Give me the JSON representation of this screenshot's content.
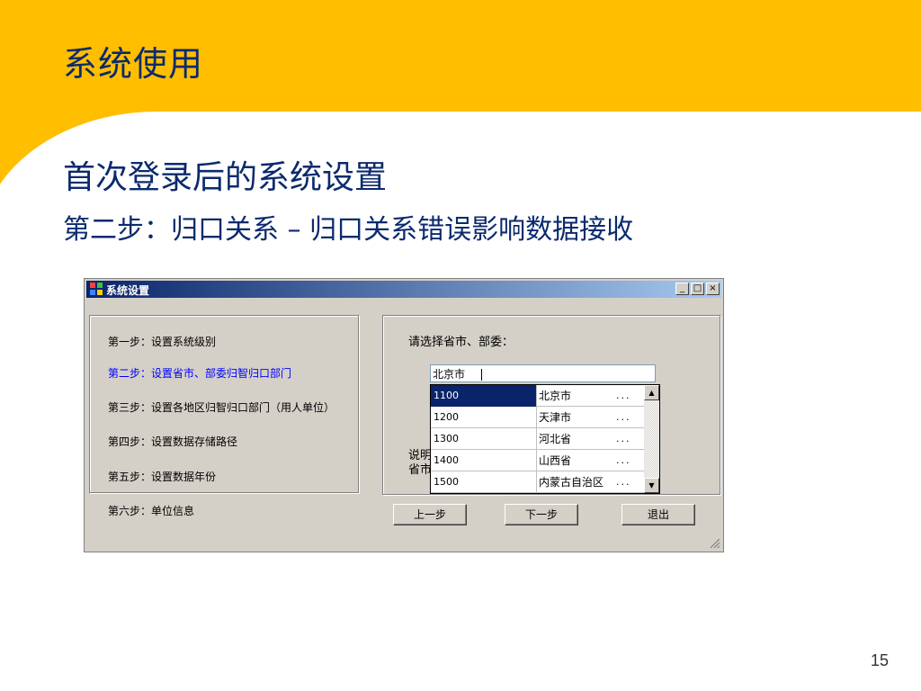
{
  "slide": {
    "title": "系统使用",
    "heading": "首次登录后的系统设置",
    "subheading": "第二步：归口关系 – 归口关系错误影响数据接收",
    "page_number": "15"
  },
  "colors": {
    "banner": "#ffbe00",
    "title_text": "#0b2a6e",
    "active_step": "#0000ff",
    "selection": "#0a246a"
  },
  "window": {
    "title": "系统设置",
    "controls": {
      "minimize": "_",
      "maximize": "□",
      "close": "×"
    },
    "steps": [
      {
        "label": "第一步：设置系统级别",
        "active": false
      },
      {
        "label": "第二步：设置省市、部委归智归口部门",
        "active": true
      },
      {
        "label": "第三步：设置各地区归智归口部门（用人单位）",
        "active": false
      },
      {
        "label": "第四步：设置数据存储路径",
        "active": false
      },
      {
        "label": "第五步：设置数据年份",
        "active": false
      },
      {
        "label": "第六步：单位信息",
        "active": false
      }
    ],
    "prompt": "请选择省市、部委：",
    "hidden_labels": [
      "说明",
      "省市"
    ],
    "combo_value": "北京市",
    "dropdown_rows": [
      {
        "code": "1100",
        "name": "北京市",
        "more": "...",
        "selected": true
      },
      {
        "code": "1200",
        "name": "天津市",
        "more": "...",
        "selected": false
      },
      {
        "code": "1300",
        "name": "河北省",
        "more": "...",
        "selected": false
      },
      {
        "code": "1400",
        "name": "山西省",
        "more": "...",
        "selected": false
      },
      {
        "code": "1500",
        "name": "内蒙古自治区",
        "more": "...",
        "selected": false
      }
    ],
    "buttons": {
      "prev": "上一步",
      "next": "下一步",
      "exit": "退出"
    }
  }
}
